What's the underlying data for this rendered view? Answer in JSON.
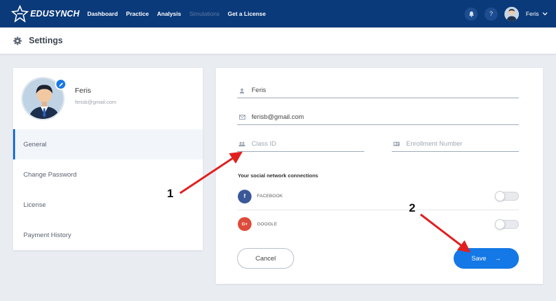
{
  "brand": {
    "name": "EDUSYNCH"
  },
  "nav": {
    "links": [
      {
        "label": "Dashboard"
      },
      {
        "label": "Practice"
      },
      {
        "label": "Analysis"
      },
      {
        "label": "Simulations"
      },
      {
        "label": "Get a License"
      }
    ],
    "notifications_icon": "bell-icon",
    "help_label": "?",
    "user_name": "Feris"
  },
  "settings_bar": {
    "title": "Settings",
    "icon": "gear-icon"
  },
  "profile": {
    "name": "Feris",
    "email": "ferisb@gmail.com"
  },
  "menu": {
    "items": [
      {
        "label": "General"
      },
      {
        "label": "Change Password"
      },
      {
        "label": "License"
      },
      {
        "label": "Payment History"
      }
    ]
  },
  "form": {
    "name_value": "Feris",
    "email_value": "ferisb@gmail.com",
    "class_id_placeholder": "Class ID",
    "enrollment_placeholder": "Enrollment Number",
    "social_title": "Your social network connections",
    "social": [
      {
        "label": "FACEBOOK",
        "icon_text": "f",
        "color": "#3b5998",
        "connected": false
      },
      {
        "label": "GOOGLE",
        "icon_text": "G+",
        "color": "#dd4b39",
        "connected": false
      }
    ],
    "cancel_label": "Cancel",
    "save_label": "Save",
    "save_arrow": "→"
  },
  "annotations": {
    "one": "1",
    "two": "2"
  },
  "colors": {
    "nav_bg": "#0b3a7a",
    "accent": "#1478e6",
    "arrow": "#e02020"
  }
}
